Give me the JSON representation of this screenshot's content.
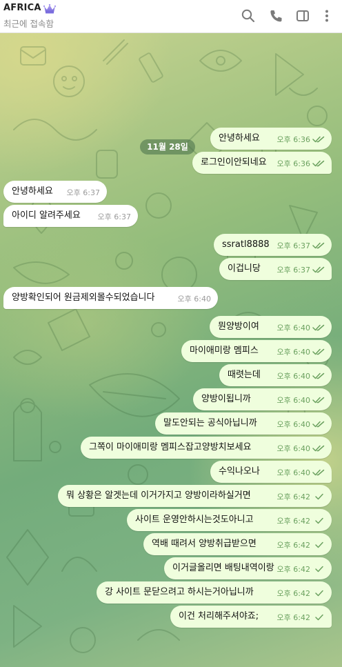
{
  "header": {
    "title": "AFRICA",
    "status": "최근에 접속함",
    "icons": [
      "crown-icon",
      "search-icon",
      "phone-icon",
      "sidebar-icon",
      "more-icon"
    ]
  },
  "colors": {
    "outgoing_bubble": "#effedd",
    "incoming_bubble": "#ffffff",
    "time_outgoing": "#6aa05e",
    "check": "#6aa05e"
  },
  "chat": {
    "date_chip": "11월 28일",
    "messages": [
      {
        "dir": "out",
        "text": "안녕하세요",
        "time": "오후 6:36",
        "read": true
      },
      {
        "dir": "out",
        "text": "로그인이안되네요",
        "time": "오후 6:36",
        "read": true
      },
      {
        "dir": "in",
        "text": "안녕하세요",
        "time": "오후 6:37"
      },
      {
        "dir": "in",
        "text": "아이디 알려주세요",
        "time": "오후 6:37"
      },
      {
        "dir": "out",
        "text": "ssratl8888",
        "time": "오후 6:37",
        "read": true
      },
      {
        "dir": "out",
        "text": "이겁니당",
        "time": "오후 6:37",
        "read": true
      },
      {
        "dir": "in",
        "text": "양방확인되어 원금제외몰수되었습니다",
        "time": "오후 6:40"
      },
      {
        "dir": "out",
        "text": "뭔양방이여",
        "time": "오후 6:40",
        "read": true
      },
      {
        "dir": "out",
        "text": "마이애미랑 멤피스",
        "time": "오후 6:40",
        "read": true
      },
      {
        "dir": "out",
        "text": "때렷는데",
        "time": "오후 6:40",
        "read": true
      },
      {
        "dir": "out",
        "text": "양방이됩니까",
        "time": "오후 6:40",
        "read": true
      },
      {
        "dir": "out",
        "text": "말도안되는 공식아닙니까",
        "time": "오후 6:40",
        "read": true
      },
      {
        "dir": "out",
        "text": "그쪽이 마이애미랑 멤피스잡고양방치보세요",
        "time": "오후 6:40",
        "read": true
      },
      {
        "dir": "out",
        "text": "수익나오나",
        "time": "오후 6:40",
        "read": true
      },
      {
        "dir": "out",
        "text": "뭐 상황은 알겟는데 이거가지고 양방이라하실거면",
        "time": "오후 6:42",
        "read": false
      },
      {
        "dir": "out",
        "text": "사이트 운영안하시는것도아니고",
        "time": "오후 6:42",
        "read": false
      },
      {
        "dir": "out",
        "text": "역배 때려서 양방취급받으면",
        "time": "오후 6:42",
        "read": false
      },
      {
        "dir": "out",
        "text": "이거글올리면 배팅내역이랑",
        "time": "오후 6:42",
        "read": false
      },
      {
        "dir": "out",
        "text": "강 사이트 문닫으려고 하시는거아닙니까",
        "time": "오후 6:42",
        "read": false
      },
      {
        "dir": "out",
        "text": "이건 처리해주셔야죠;",
        "time": "오후 6:42",
        "read": false
      }
    ]
  }
}
